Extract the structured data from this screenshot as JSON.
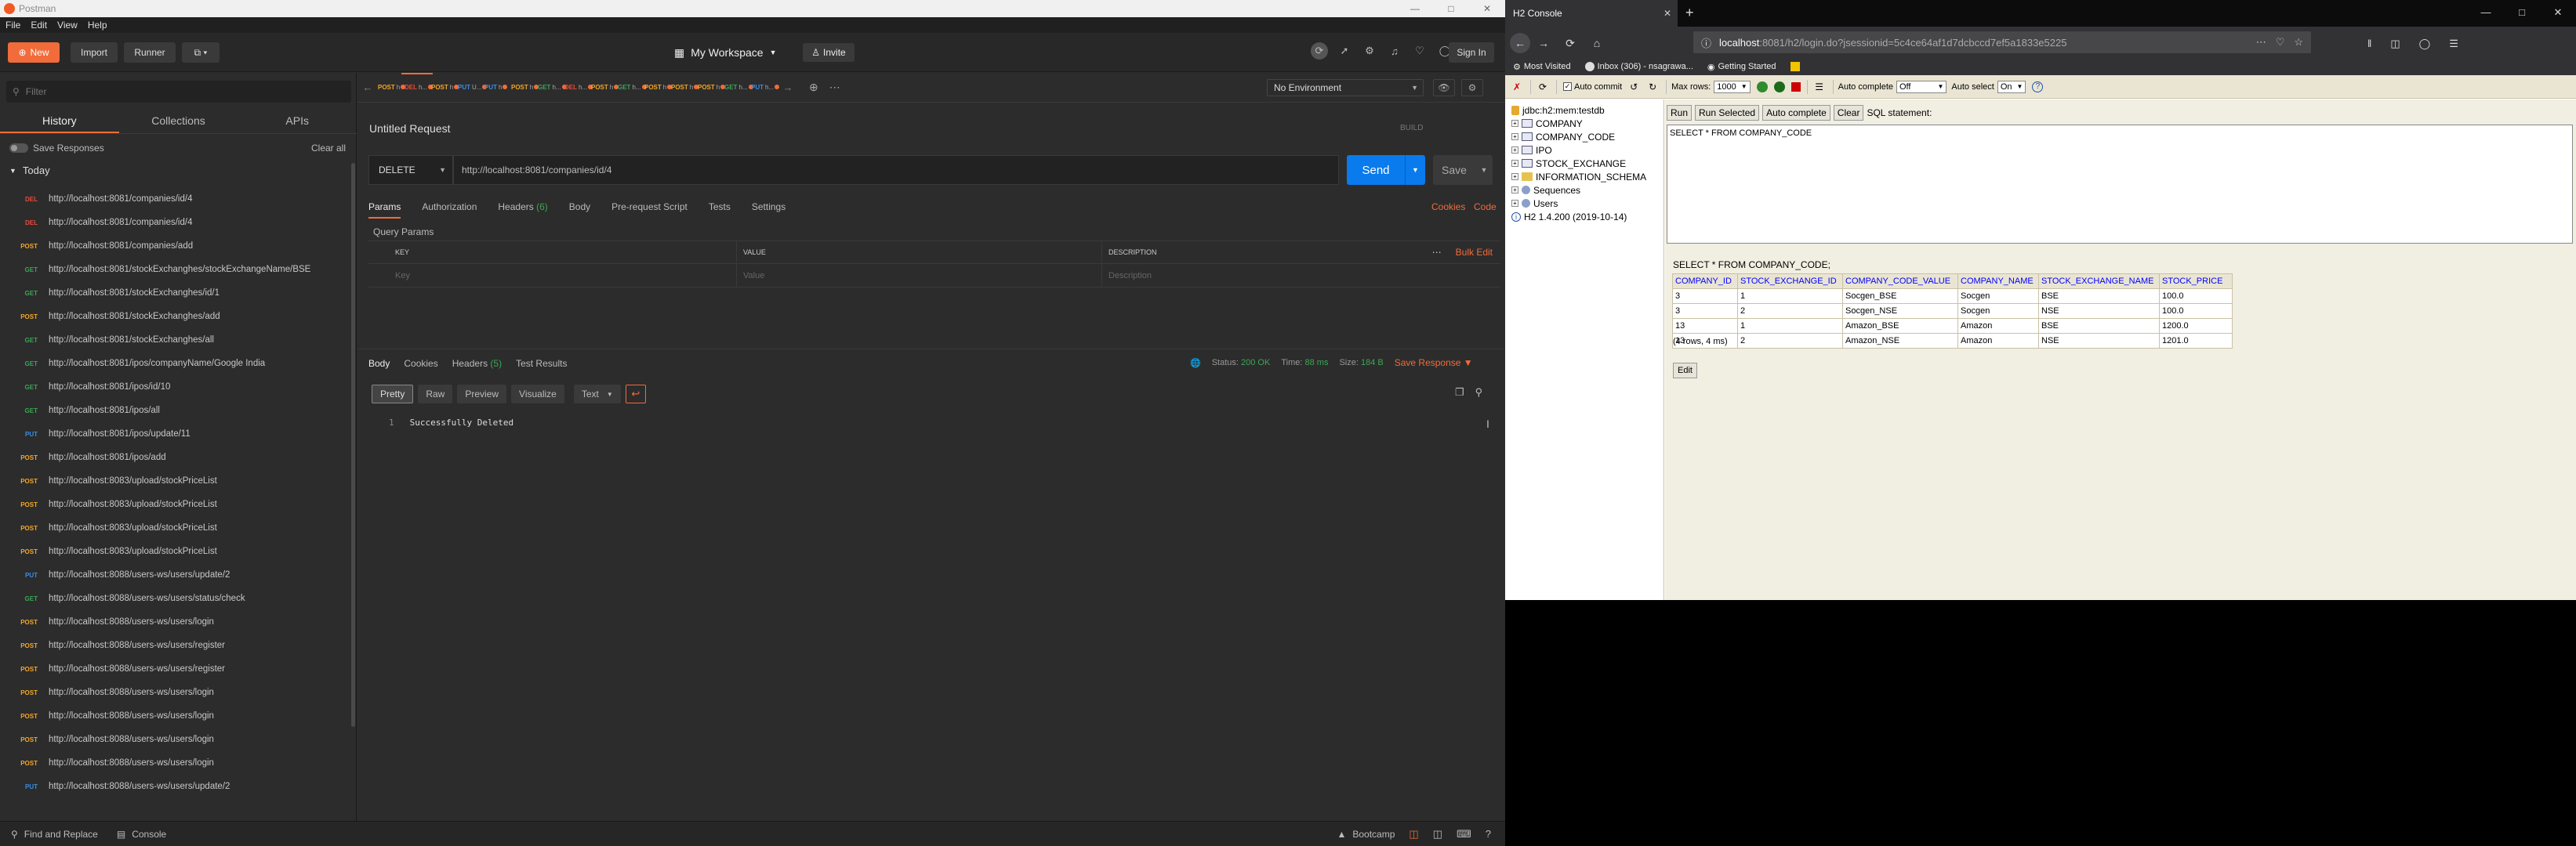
{
  "postman": {
    "title": "Postman",
    "menu": [
      "File",
      "Edit",
      "View",
      "Help"
    ],
    "toolbar": {
      "new_label": "New",
      "import_label": "Import",
      "runner_label": "Runner",
      "workspace_label": "My Workspace",
      "invite_label": "Invite",
      "signin_label": "Sign In"
    },
    "sidebar": {
      "search_placeholder": "Filter",
      "tabs": [
        "History",
        "Collections",
        "APIs"
      ],
      "save_responses": "Save Responses",
      "clear_all": "Clear all",
      "group": "Today",
      "history": [
        {
          "method": "DEL",
          "color": "#e74c3c",
          "url": "http://localhost:8081/companies/id/4"
        },
        {
          "method": "DEL",
          "color": "#e74c3c",
          "url": "http://localhost:8081/companies/id/4"
        },
        {
          "method": "POST",
          "color": "#f5a623",
          "url": "http://localhost:8081/companies/add"
        },
        {
          "method": "GET",
          "color": "#3aa757",
          "url": "http://localhost:8081/stockExchanghes/stockExchangeName/BSE"
        },
        {
          "method": "GET",
          "color": "#3aa757",
          "url": "http://localhost:8081/stockExchanghes/id/1"
        },
        {
          "method": "POST",
          "color": "#f5a623",
          "url": "http://localhost:8081/stockExchanghes/add"
        },
        {
          "method": "GET",
          "color": "#3aa757",
          "url": "http://localhost:8081/stockExchanghes/all"
        },
        {
          "method": "GET",
          "color": "#3aa757",
          "url": "http://localhost:8081/ipos/companyName/Google India"
        },
        {
          "method": "GET",
          "color": "#3aa757",
          "url": "http://localhost:8081/ipos/id/10"
        },
        {
          "method": "GET",
          "color": "#3aa757",
          "url": "http://localhost:8081/ipos/all"
        },
        {
          "method": "PUT",
          "color": "#3a8ee6",
          "url": "http://localhost:8081/ipos/update/11"
        },
        {
          "method": "POST",
          "color": "#f5a623",
          "url": "http://localhost:8081/ipos/add"
        },
        {
          "method": "POST",
          "color": "#f5a623",
          "url": "http://localhost:8083/upload/stockPriceList"
        },
        {
          "method": "POST",
          "color": "#f5a623",
          "url": "http://localhost:8083/upload/stockPriceList"
        },
        {
          "method": "POST",
          "color": "#f5a623",
          "url": "http://localhost:8083/upload/stockPriceList"
        },
        {
          "method": "POST",
          "color": "#f5a623",
          "url": "http://localhost:8083/upload/stockPriceList"
        },
        {
          "method": "PUT",
          "color": "#3a8ee6",
          "url": "http://localhost:8088/users-ws/users/update/2"
        },
        {
          "method": "GET",
          "color": "#3aa757",
          "url": "http://localhost:8088/users-ws/users/status/check"
        },
        {
          "method": "POST",
          "color": "#f5a623",
          "url": "http://localhost:8088/users-ws/users/login"
        },
        {
          "method": "POST",
          "color": "#f5a623",
          "url": "http://localhost:8088/users-ws/users/register"
        },
        {
          "method": "POST",
          "color": "#f5a623",
          "url": "http://localhost:8088/users-ws/users/register"
        },
        {
          "method": "POST",
          "color": "#f5a623",
          "url": "http://localhost:8088/users-ws/users/login"
        },
        {
          "method": "POST",
          "color": "#f5a623",
          "url": "http://localhost:8088/users-ws/users/login"
        },
        {
          "method": "POST",
          "color": "#f5a623",
          "url": "http://localhost:8088/users-ws/users/login"
        },
        {
          "method": "POST",
          "color": "#f5a623",
          "url": "http://localhost:8088/users-ws/users/login"
        },
        {
          "method": "PUT",
          "color": "#3a8ee6",
          "url": "http://localhost:8088/users-ws/users/update/2"
        }
      ]
    },
    "request_tabs": [
      {
        "method": "POST",
        "color": "#f5a623",
        "label": "h"
      },
      {
        "method": "DEL",
        "color": "#e74c3c",
        "label": "h..."
      },
      {
        "method": "POST",
        "color": "#f5a623",
        "label": "h"
      },
      {
        "method": "PUT",
        "color": "#3a8ee6",
        "label": "U..."
      },
      {
        "method": "PUT",
        "color": "#3a8ee6",
        "label": "h"
      },
      {
        "method": "POST",
        "color": "#f5a623",
        "label": "h"
      },
      {
        "method": "GET",
        "color": "#3aa757",
        "label": "h..."
      },
      {
        "method": "DEL",
        "color": "#e74c3c",
        "label": "h..."
      },
      {
        "method": "POST",
        "color": "#f5a623",
        "label": "h"
      },
      {
        "method": "GET",
        "color": "#3aa757",
        "label": "h..."
      },
      {
        "method": "POST",
        "color": "#f5a623",
        "label": "h"
      },
      {
        "method": "POST",
        "color": "#f5a623",
        "label": "h"
      },
      {
        "method": "POST",
        "color": "#f5a623",
        "label": "h"
      },
      {
        "method": "GET",
        "color": "#3aa757",
        "label": "h..."
      },
      {
        "method": "PUT",
        "color": "#3a8ee6",
        "label": "h..."
      }
    ],
    "environment": "No Environment",
    "request": {
      "title": "Untitled Request",
      "build_label": "BUILD",
      "method": "DELETE",
      "url": "http://localhost:8081/companies/id/4",
      "send_label": "Send",
      "save_label": "Save",
      "tabs": {
        "params": "Params",
        "authorization": "Authorization",
        "headers": "Headers",
        "headers_count": "(6)",
        "body": "Body",
        "prerequest": "Pre-request Script",
        "tests": "Tests",
        "settings": "Settings"
      },
      "cookies_link": "Cookies",
      "code_link": "Code",
      "query_params_title": "Query Params",
      "cols": {
        "key": "KEY",
        "value": "VALUE",
        "description": "DESCRIPTION",
        "bulk_edit": "Bulk Edit"
      },
      "placeholders": {
        "key": "Key",
        "value": "Value",
        "description": "Description"
      }
    },
    "response": {
      "tabs": {
        "body": "Body",
        "cookies": "Cookies",
        "headers": "Headers",
        "headers_count": "(5)",
        "test_results": "Test Results"
      },
      "status_label": "Status:",
      "status_value": "200 OK",
      "time_label": "Time:",
      "time_value": "88 ms",
      "size_label": "Size:",
      "size_value": "184 B",
      "save_response": "Save Response",
      "views": [
        "Pretty",
        "Raw",
        "Preview",
        "Visualize"
      ],
      "format": "Text",
      "line_number": "1",
      "content": "Successfully Deleted"
    },
    "status_bar": {
      "find_replace": "Find and Replace",
      "console": "Console",
      "bootcamp": "Bootcamp"
    }
  },
  "firefox": {
    "tab_title": "H2 Console",
    "url_host": "localhost",
    "url_rest": ":8081/h2/login.do?jsessionid=5c4ce64af1d7dcbccd7ef5a1833e5225",
    "bookmarks": [
      "Most Visited",
      "Inbox (306) - nsagrawa...",
      "Getting Started"
    ],
    "h2": {
      "toolbar": {
        "auto_commit": "Auto commit",
        "max_rows_label": "Max rows:",
        "max_rows_value": "1000",
        "auto_complete_label": "Auto complete",
        "auto_complete_value": "Off",
        "auto_select_label": "Auto select",
        "auto_select_value": "On"
      },
      "tree": {
        "db": "jdbc:h2:mem:testdb",
        "tables": [
          "COMPANY",
          "COMPANY_CODE",
          "IPO",
          "STOCK_EXCHANGE",
          "INFORMATION_SCHEMA",
          "Sequences",
          "Users"
        ],
        "version": "H2 1.4.200 (2019-10-14)"
      },
      "buttons": [
        "Run",
        "Run Selected",
        "Auto complete",
        "Clear"
      ],
      "sql_label": "SQL statement:",
      "sql": "SELECT * FROM COMPANY_CODE",
      "result_query": "SELECT * FROM COMPANY_CODE;",
      "columns": [
        "COMPANY_ID",
        "STOCK_EXCHANGE_ID",
        "COMPANY_CODE_VALUE",
        "COMPANY_NAME",
        "STOCK_EXCHANGE_NAME",
        "STOCK_PRICE"
      ],
      "rows": [
        [
          "3",
          "1",
          "Socgen_BSE",
          "Socgen",
          "BSE",
          "100.0"
        ],
        [
          "3",
          "2",
          "Socgen_NSE",
          "Socgen",
          "NSE",
          "100.0"
        ],
        [
          "13",
          "1",
          "Amazon_BSE",
          "Amazon",
          "BSE",
          "1200.0"
        ],
        [
          "13",
          "2",
          "Amazon_NSE",
          "Amazon",
          "NSE",
          "1201.0"
        ]
      ],
      "row_count": "(4 rows, 4 ms)",
      "edit_label": "Edit"
    }
  }
}
